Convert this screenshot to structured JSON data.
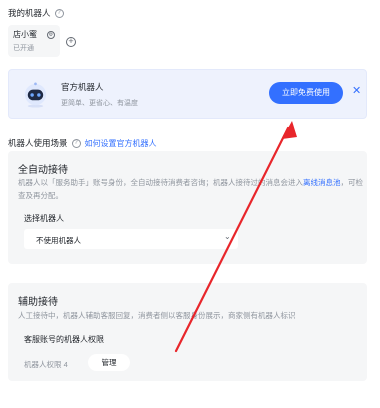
{
  "header": {
    "title": "我的机器人",
    "help_icon": "question-circle-icon"
  },
  "bot_chip": {
    "name": "店小蜜",
    "status": "已开通"
  },
  "promo": {
    "title": "官方机器人",
    "tags": "更简单、更省心、有温度",
    "cta_label": "立即免费使用",
    "close_glyph": "✕"
  },
  "scene": {
    "title": "机器人使用场景",
    "link": "如何设置官方机器人"
  },
  "auto_reception": {
    "title": "全自动接待",
    "desc_part1": "机器人以「服务助手」账号身份，全自动接待消费者咨询；机器人接待过的消息会进入",
    "desc_link": "离线消息池",
    "desc_part2": "，可检查及再分配。",
    "select_label": "选择机器人",
    "select_value": "不使用机器人"
  },
  "assist_reception": {
    "title": "辅助接待",
    "desc": "人工接待中，机器人辅助客服回复，消费者侧以客服身份展示，商家侧有机器人标识",
    "sub_title": "客服账号的机器人权限",
    "permission": "机器人权限 4",
    "manage_label": "管理"
  },
  "colors": {
    "accent": "#3370ff",
    "annotation": "#e8262b"
  }
}
